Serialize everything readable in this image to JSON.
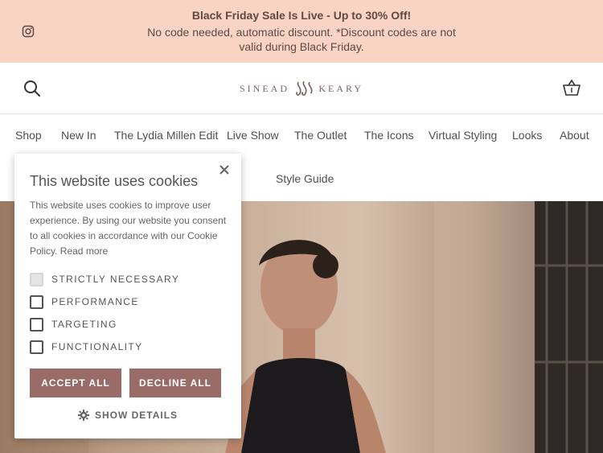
{
  "announcement": {
    "title": "Black Friday Sale Is Live - Up to 30% Off!",
    "body": "No code needed, automatic discount. *Discount codes are not valid during Black Friday.",
    "social_icon": "instagram-icon"
  },
  "header": {
    "logo_left": "SINEAD",
    "logo_right": "KEARY",
    "search_icon": "search-icon",
    "basket_icon": "basket-icon"
  },
  "nav": {
    "items": [
      "Shop",
      "New In",
      "The Lydia Millen Edit",
      "Live Show",
      "The Outlet",
      "The Icons",
      "Virtual Styling",
      "Looks",
      "About"
    ],
    "row2": [
      "Style Guide"
    ]
  },
  "cookie": {
    "title": "This website uses cookies",
    "description": "This website uses cookies to improve user experience. By using our website you consent to all cookies in accordance with our Cookie Policy.",
    "read_more": "Read more",
    "options": [
      {
        "label": "STRICTLY NECESSARY",
        "checked": true
      },
      {
        "label": "PERFORMANCE",
        "checked": false
      },
      {
        "label": "TARGETING",
        "checked": false
      },
      {
        "label": "FUNCTIONALITY",
        "checked": false
      }
    ],
    "accept": "ACCEPT ALL",
    "decline": "DECLINE ALL",
    "details": "SHOW DETAILS"
  },
  "colors": {
    "announcement_bg": "#f9d3c3",
    "button": "#9a6c68"
  }
}
